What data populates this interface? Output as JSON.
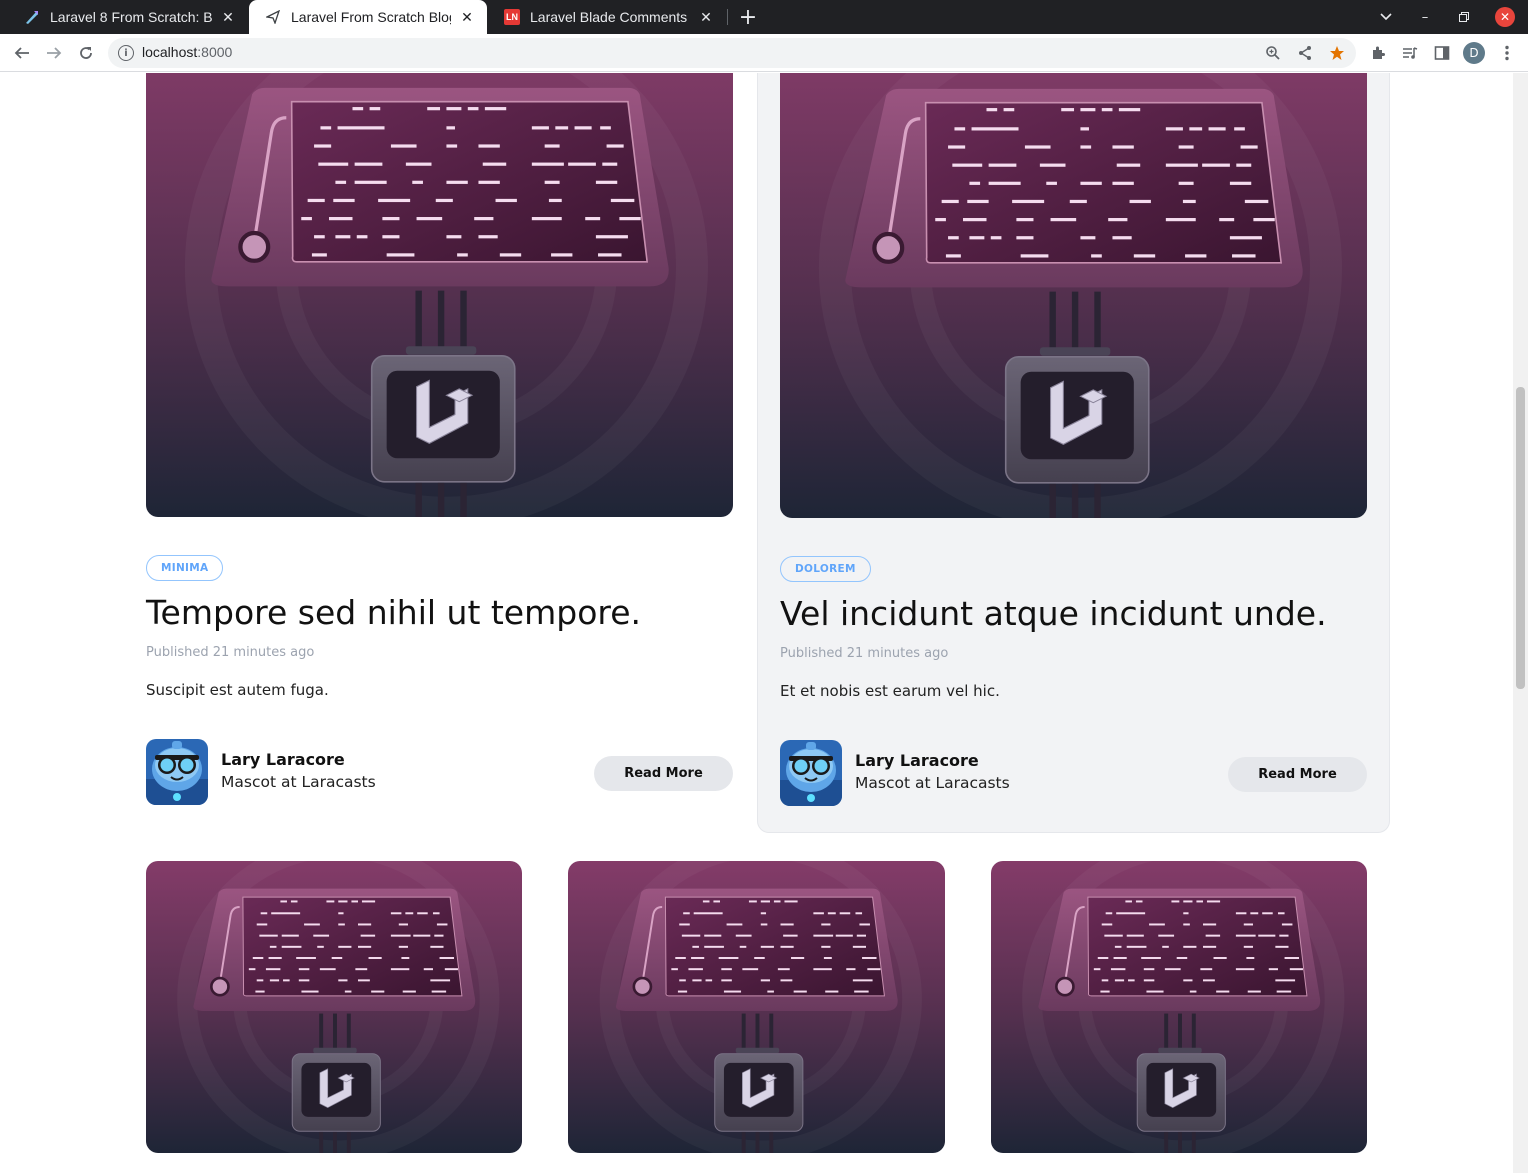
{
  "browser": {
    "tabs": [
      {
        "title": "Laravel 8 From Scratch: Bl",
        "favicon": "laracasts-icon",
        "active": false
      },
      {
        "title": "Laravel From Scratch Blog",
        "favicon": "paper-plane-icon",
        "active": true
      },
      {
        "title": "Laravel Blade Comments |",
        "favicon": "ln-icon",
        "active": false
      }
    ],
    "url_host": "localhost",
    "url_port": ":8000",
    "profile_initial": "D"
  },
  "posts_featured": [
    {
      "category": "MINIMA",
      "title": "Tempore sed nihil ut tempore.",
      "published_label": "Published",
      "published_ago": "21 minutes ago",
      "excerpt": "Suscipit est autem fuga.",
      "author_name": "Lary Laracore",
      "author_role": "Mascot at Laracasts",
      "read_more": "Read More"
    },
    {
      "category": "DOLOREM",
      "title": "Vel incidunt atque incidunt unde.",
      "published_label": "Published",
      "published_ago": "21 minutes ago",
      "excerpt": "Et et nobis est earum vel hic.",
      "author_name": "Lary Laracore",
      "author_role": "Mascot at Laracasts",
      "read_more": "Read More"
    }
  ],
  "colors": {
    "tag_border": "#93c5fd",
    "tag_text": "#60a5fa",
    "thumb_top": "#8a3d6c",
    "thumb_bottom": "#1e2536"
  }
}
